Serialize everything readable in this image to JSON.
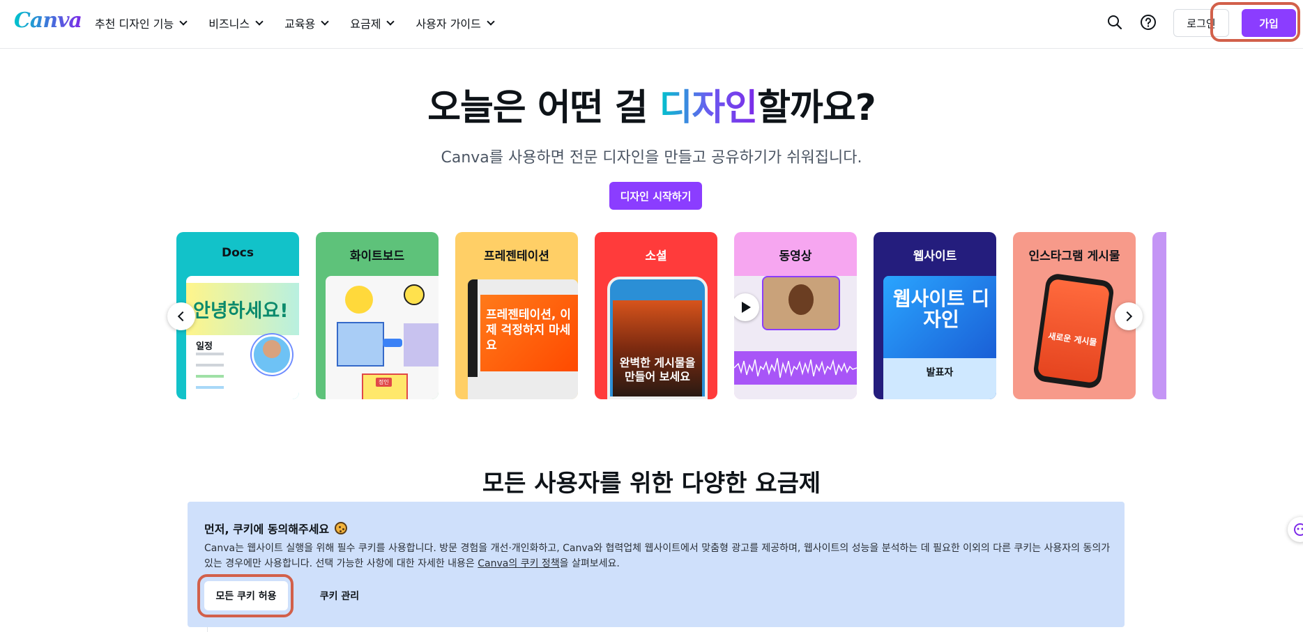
{
  "header": {
    "logo": "Canva",
    "nav": [
      "추천 디자인 기능",
      "비즈니스",
      "교육용",
      "요금제",
      "사용자 가이드"
    ],
    "login_label": "로그인",
    "signup_label": "가입",
    "icons": [
      "search-icon",
      "help-icon"
    ]
  },
  "hero": {
    "title_prefix": "오늘은 어떤 걸 ",
    "title_highlight": "디자인",
    "title_suffix": "할까요?",
    "subtitle": "Canva를 사용하면 전문 디자인을 만들고 공유하기가 쉬워집니다.",
    "cta_label": "디자인 시작하기"
  },
  "carousel": {
    "cards": [
      {
        "label": "Docs",
        "bg": "#12c2c9",
        "text": "안녕하세요!",
        "sub": "일정"
      },
      {
        "label": "화이트보드",
        "bg": "#5ec27a",
        "tag": "정인"
      },
      {
        "label": "프레젠테이션",
        "bg": "#ffcf66",
        "text": "프레젠테이션, 이제 걱정하지 마세요"
      },
      {
        "label": "소셜",
        "bg": "#ff3b3b",
        "text": "완벽한 게시물을 만들어 보세요"
      },
      {
        "label": "동영상",
        "bg": "#f6a6f0"
      },
      {
        "label": "웹사이트",
        "bg": "#241d7d",
        "text": "웹사이트 디자인",
        "sub": "발표자"
      },
      {
        "label": "인스타그램 게시물",
        "bg": "#f79a8a",
        "text": "새로운 게시물"
      }
    ],
    "icons": [
      "chevron-left-icon",
      "chevron-right-icon",
      "play-icon"
    ]
  },
  "section": {
    "title": "모든 사용자를 위한 다양한 요금제"
  },
  "cookie": {
    "title": "먼저, 쿠키에 동의해주세요",
    "text_before": "Canva는 웹사이트 실행을 위해 필수 쿠키를 사용합니다. 방문 경험을 개선·개인화하고, Canva와 협력업체 웹사이트에서 맞춤형 광고를 제공하며, 웹사이트의 성능을 분석하는 데 필요한 이외의 다른 쿠키는 사용자의 동의가 있는 경우에만 사용합니다. 선택 가능한 사항에 대한 자세한 내용은 ",
    "link": "Canva의 쿠키 정책",
    "text_after": "을 살펴보세요.",
    "accept_label": "모든 쿠키 허용",
    "manage_label": "쿠키 관리"
  },
  "colors": {
    "accent": "#8b3dff",
    "highlight_ring": "#d2604a",
    "cookie_bg": "#cfe0fb"
  }
}
